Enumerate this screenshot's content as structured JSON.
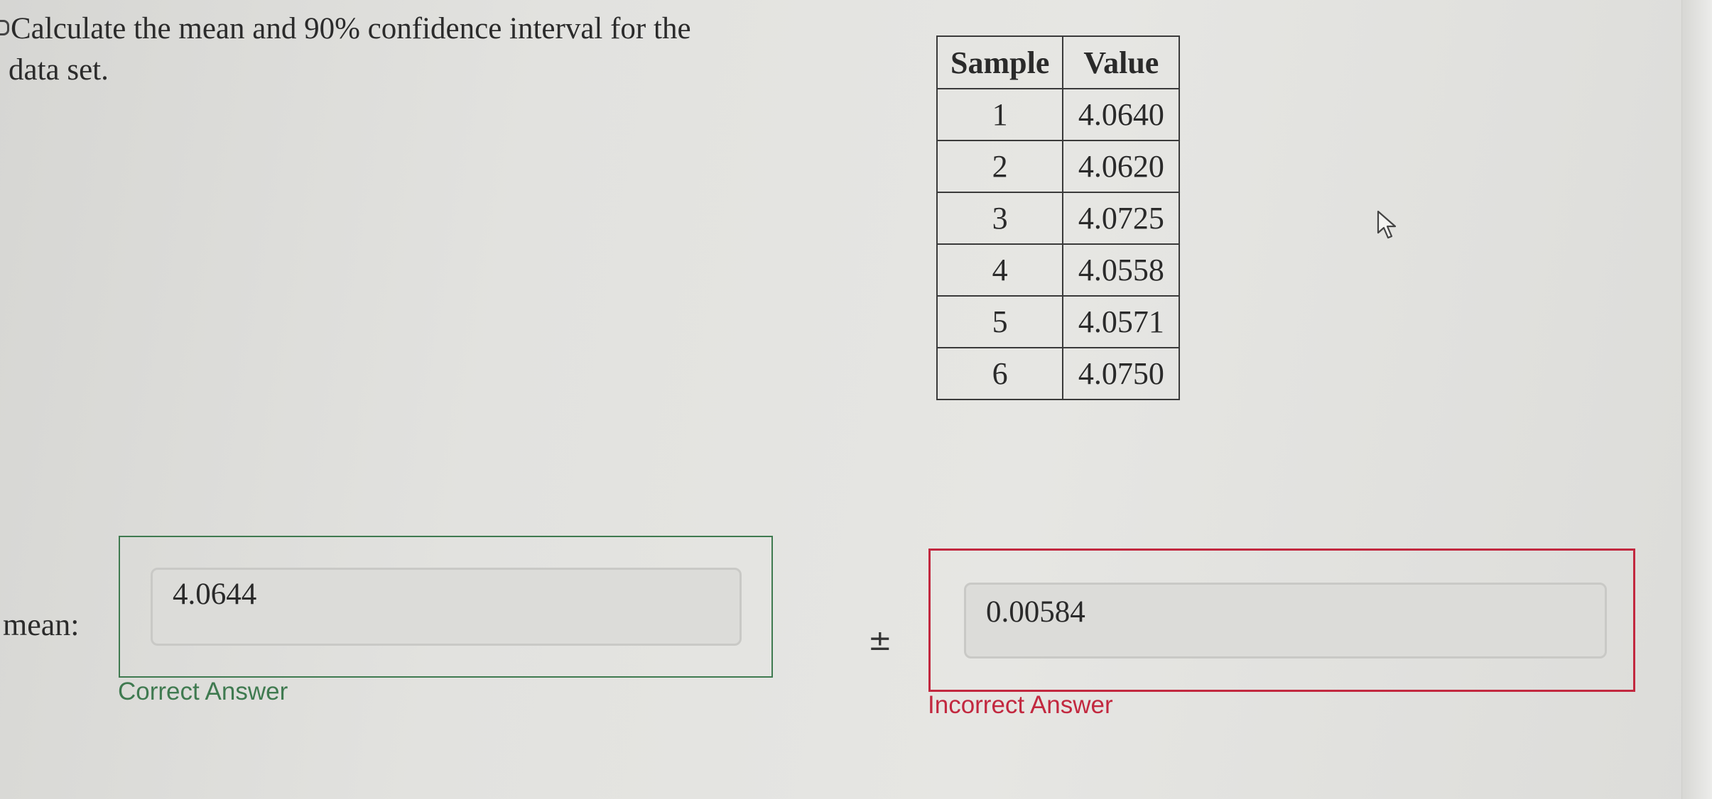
{
  "question": {
    "line1": "Calculate the mean and 90% confidence interval for the",
    "line2": "data set."
  },
  "table": {
    "headers": [
      "Sample",
      "Value"
    ],
    "rows": [
      {
        "sample": "1",
        "value": "4.0640"
      },
      {
        "sample": "2",
        "value": "4.0620"
      },
      {
        "sample": "3",
        "value": "4.0725"
      },
      {
        "sample": "4",
        "value": "4.0558"
      },
      {
        "sample": "5",
        "value": "4.0571"
      },
      {
        "sample": "6",
        "value": "4.0750"
      }
    ]
  },
  "mean": {
    "label": "mean:",
    "value": "4.0644",
    "feedback": "Correct Answer"
  },
  "plus_minus": "±",
  "interval": {
    "value": "0.00584",
    "feedback": "Incorrect Answer"
  },
  "colors": {
    "correct": "#3f7a50",
    "incorrect": "#c2283f"
  },
  "icons": {
    "cursor": "mouse-pointer-icon"
  }
}
